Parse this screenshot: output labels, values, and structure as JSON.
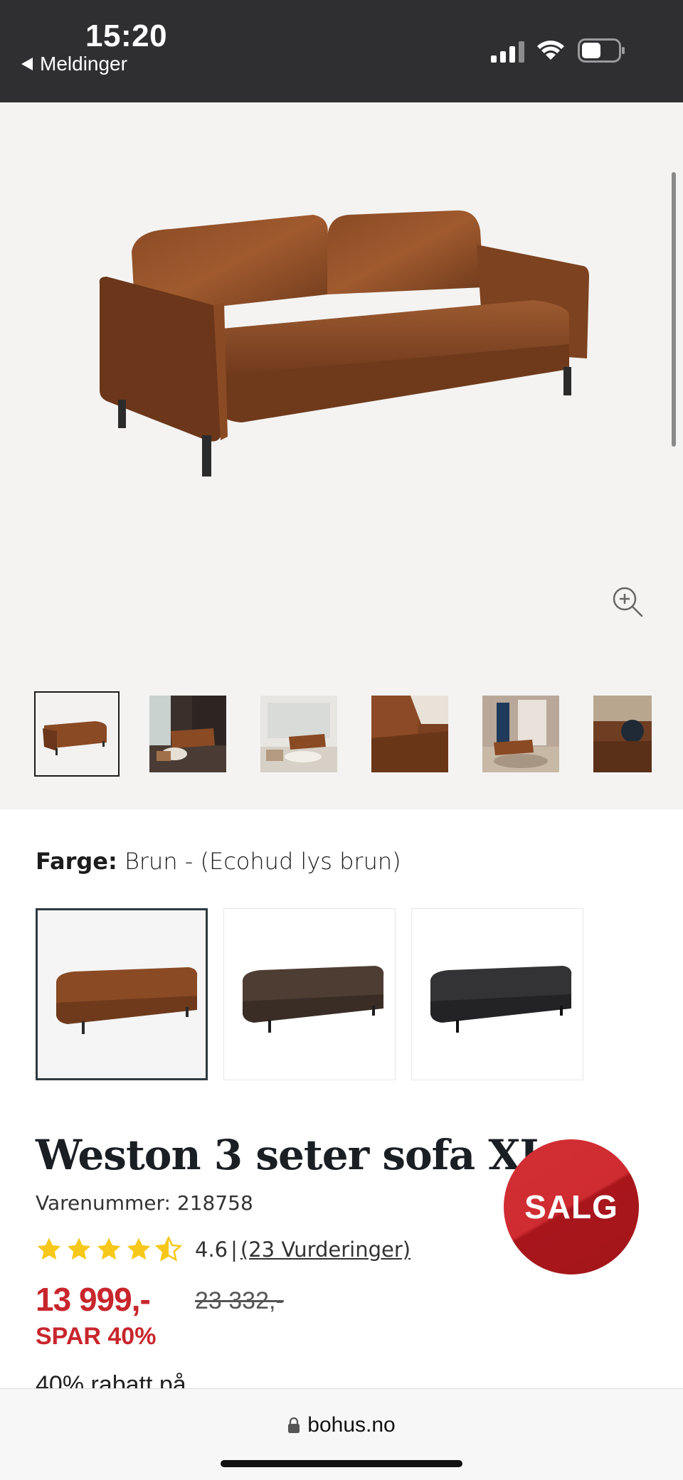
{
  "status_bar": {
    "time": "15:20",
    "back_label": "Meldinger",
    "icons": [
      "signal-icon",
      "wifi-icon",
      "battery-icon"
    ]
  },
  "gallery": {
    "hero_alt": "sofa",
    "zoom_icon": "zoom-in-icon",
    "thumbnail_count": 6,
    "selected_thumbnail": 1
  },
  "color": {
    "label": "Farge:",
    "value": "Brun - (Ecohud lys brun)",
    "swatches": [
      "brown",
      "dark-brown",
      "black"
    ],
    "selected_swatch": 1
  },
  "product": {
    "title": "Weston 3 seter sofa XL",
    "sku": "Varenummer: 218758",
    "rating": {
      "stars": 4.5,
      "score": "4.6",
      "separator": "|",
      "reviews": "(23 Vurderinger)"
    },
    "price": "13 999,-",
    "old_price": "23 332,-",
    "savings": "SPAR 40%",
    "promo_text": "40% rabatt på",
    "badge": "SALG"
  },
  "browser": {
    "url": "bohus.no"
  },
  "colors": {
    "status_bar_bg": "#2f2f31",
    "gallery_bg": "#f4f3f2",
    "price_red": "#c8262d",
    "star_yellow": "#f7c81a"
  }
}
